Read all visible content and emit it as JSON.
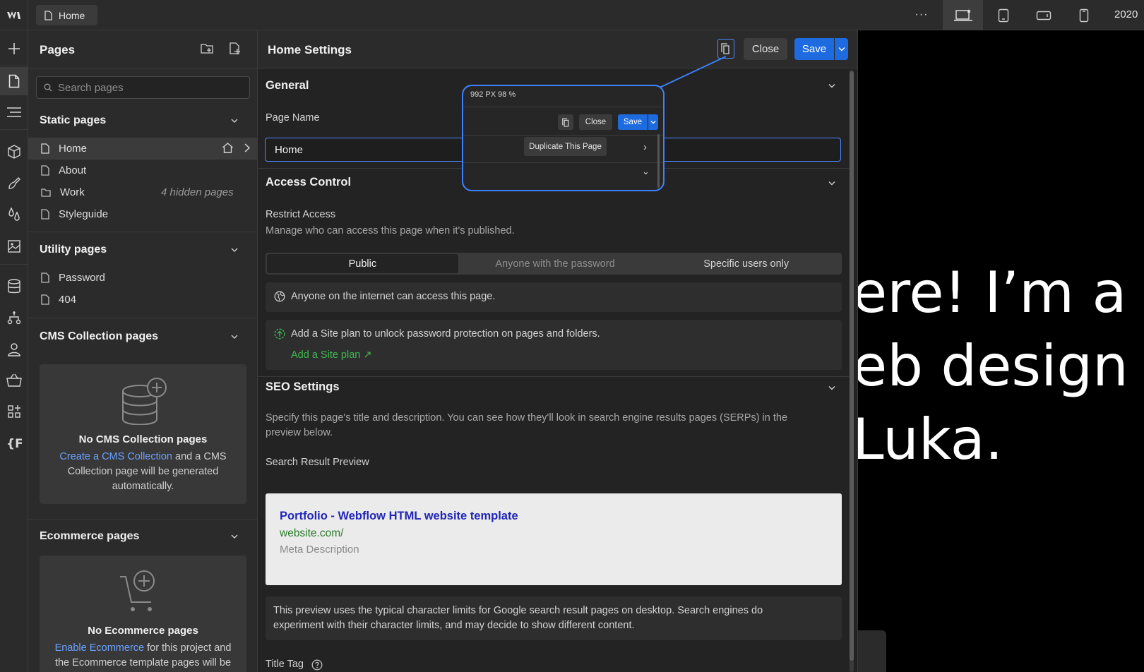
{
  "topbar": {
    "page_chip_label": "Home",
    "more_label": "···",
    "width_value": "2020"
  },
  "pages_panel": {
    "title": "Pages",
    "search_placeholder": "Search pages",
    "static": {
      "title": "Static pages",
      "items": [
        {
          "label": "Home",
          "icon": "page-icon"
        },
        {
          "label": "About",
          "icon": "page-icon"
        },
        {
          "label": "Work",
          "icon": "folder-icon",
          "note": "4 hidden pages"
        },
        {
          "label": "Styleguide",
          "icon": "page-icon"
        }
      ]
    },
    "utility": {
      "title": "Utility pages",
      "items": [
        {
          "label": "Password"
        },
        {
          "label": "404"
        }
      ]
    },
    "cms": {
      "title": "CMS Collection pages",
      "empty_title": "No CMS Collection pages",
      "empty_link": "Create a CMS Collection",
      "empty_rest_1": " and a CMS",
      "empty_line_2": "Collection page will be generated",
      "empty_line_3": "automatically."
    },
    "ecommerce": {
      "title": "Ecommerce pages",
      "empty_title": "No Ecommerce pages",
      "empty_link": "Enable Ecommerce",
      "empty_rest_1": " for this project and",
      "empty_line_2": "the Ecommerce template pages will be"
    }
  },
  "settings": {
    "title": "Home Settings",
    "close_label": "Close",
    "save_label": "Save",
    "general": {
      "title": "General",
      "page_name_label": "Page Name",
      "page_name_value": "Home"
    },
    "access": {
      "title": "Access Control",
      "restrict_label": "Restrict Access",
      "restrict_help": "Manage who can access this page when it's published.",
      "options": [
        "Public",
        "Anyone with the password",
        "Specific users only"
      ],
      "selected": "Public",
      "public_note": "Anyone on the internet can access this page.",
      "plan_note": "Add a Site plan to unlock password protection on pages and folders.",
      "plan_link": "Add a Site plan ↗"
    },
    "seo": {
      "title": "SEO Settings",
      "help_line_1": "Specify this page's title and description. You can see how they'll look in search engine results pages (SERPs) in the",
      "help_line_2": "preview below.",
      "preview_label": "Search Result Preview",
      "preview_title": "Portfolio - Webflow HTML website template",
      "preview_url": "website.com/",
      "preview_desc": "Meta Description",
      "limits_line_1": "This preview uses the typical character limits for Google search result pages on desktop. Search engines do",
      "limits_line_2": "experiment with their character limits, and may decide to show different content.",
      "title_tag_label": "Title Tag"
    }
  },
  "canvas": {
    "hero_lines": [
      "ere! I’m a",
      "eb design",
      "Luka."
    ]
  },
  "callout": {
    "size_label": "992 PX  98 %",
    "close_label": "Close",
    "save_label": "Save",
    "tooltip": "Duplicate This Page",
    "arrow_right": "›",
    "chevron": "⌄"
  },
  "colors": {
    "accent": "#1d6bdf",
    "focus": "#4f8bff",
    "link": "#6aa2ff",
    "success": "#3fb950",
    "serp_title": "#2226b8",
    "serp_url": "#2b7a2b"
  }
}
